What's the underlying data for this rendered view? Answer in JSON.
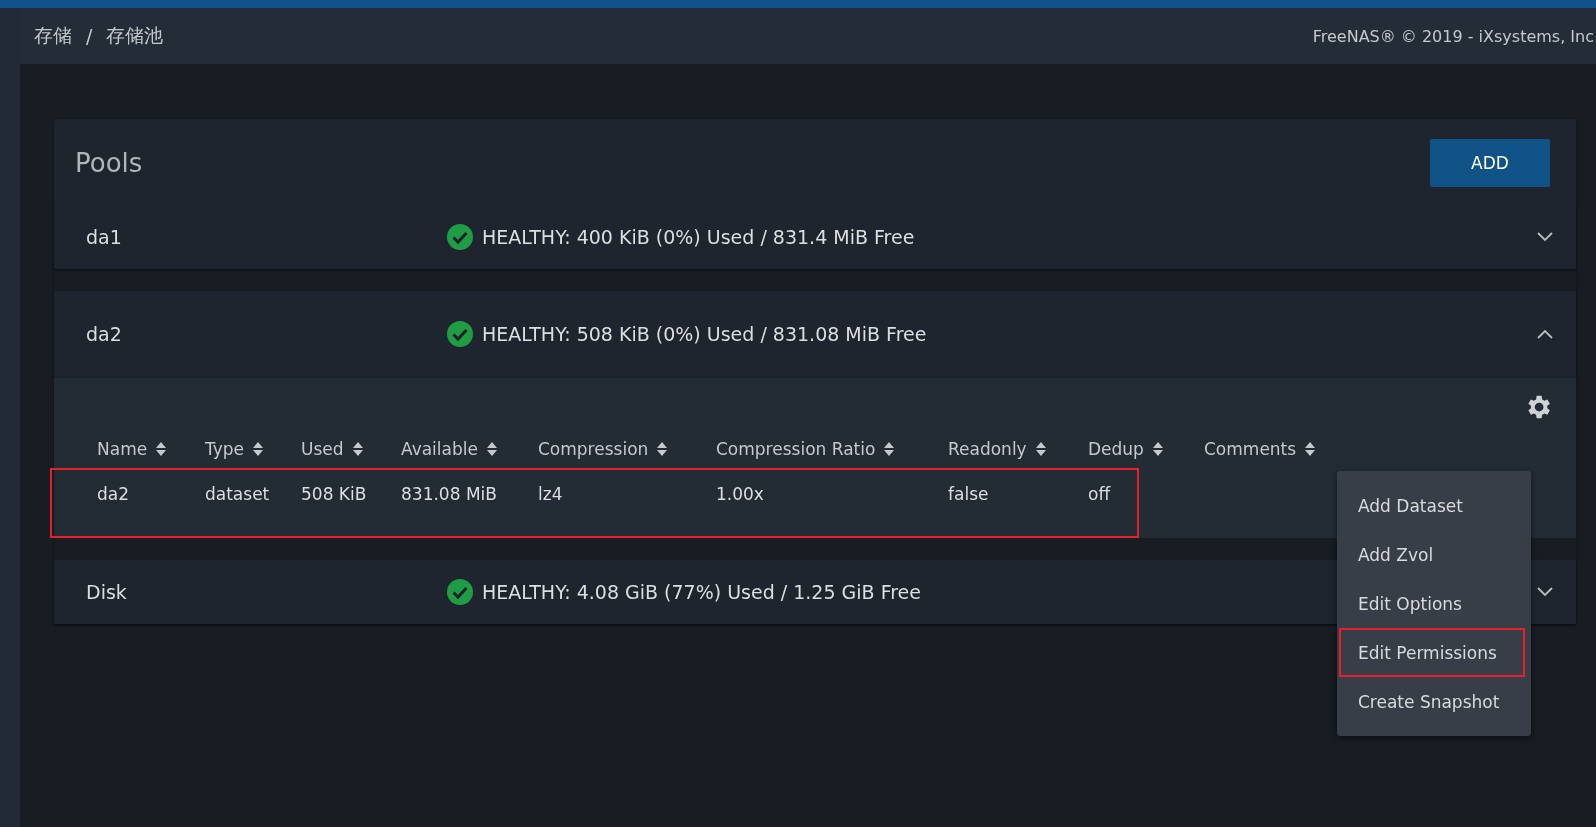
{
  "breadcrumb": [
    "存储",
    "存储池"
  ],
  "breadcrumb_separator": "/",
  "copyright": "FreeNAS® © 2019 - iXsystems, Inc",
  "card": {
    "title": "Pools",
    "add_button": "ADD"
  },
  "pools": [
    {
      "name": "da1",
      "status": "HEALTHY: 400 KiB (0%) Used / 831.4 MiB Free",
      "expanded": false
    },
    {
      "name": "da2",
      "status": "HEALTHY: 508 KiB (0%) Used / 831.08 MiB Free",
      "expanded": true,
      "table": {
        "columns": [
          "Name",
          "Type",
          "Used",
          "Available",
          "Compression",
          "Compression Ratio",
          "Readonly",
          "Dedup",
          "Comments"
        ],
        "rows": [
          {
            "cells": [
              "da2",
              "dataset",
              "508 KiB",
              "831.08 MiB",
              "lz4",
              "1.00x",
              "false",
              "off"
            ],
            "highlighted": true
          }
        ]
      }
    },
    {
      "name": "Disk",
      "status": "HEALTHY: 4.08 GiB (77%) Used / 1.25 GiB Free",
      "expanded": false
    }
  ],
  "menu": [
    {
      "label": "Add Dataset",
      "highlighted": false
    },
    {
      "label": "Add Zvol",
      "highlighted": false
    },
    {
      "label": "Edit Options",
      "highlighted": false
    },
    {
      "label": "Edit Permissions",
      "highlighted": true
    },
    {
      "label": "Create Snapshot",
      "highlighted": false
    }
  ]
}
